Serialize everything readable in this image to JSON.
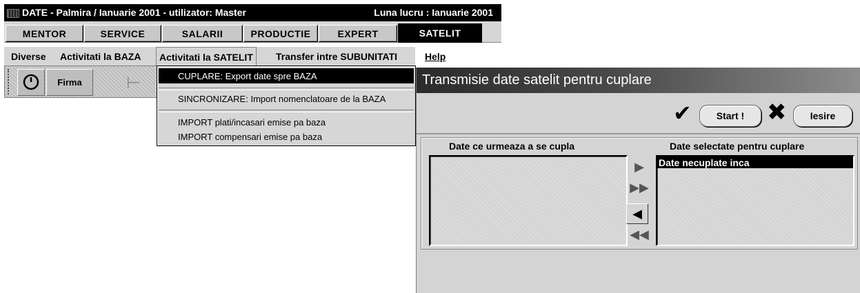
{
  "window": {
    "title": "DATE - Palmira / Ianuarie 2001 - utilizator: Master",
    "working_month": "Luna lucru : Ianuarie 2001"
  },
  "modules": [
    {
      "label": "MENTOR",
      "active": false
    },
    {
      "label": "SERVICE",
      "active": false
    },
    {
      "label": "SALARII",
      "active": false
    },
    {
      "label": "PRODUCTIE",
      "active": false
    },
    {
      "label": "EXPERT",
      "active": false
    },
    {
      "label": "SATELIT",
      "active": true
    }
  ],
  "menu": {
    "items": [
      "Diverse",
      "Activitati la BAZA",
      "Activitati la SATELIT",
      "Transfer intre SUBUNITATI",
      "Help"
    ],
    "open_item": "Activitati la SATELIT"
  },
  "toolbar": {
    "firma_label": "Firma",
    "icons": [
      "clock-icon",
      "sigma-icon"
    ]
  },
  "dropdown": {
    "items": [
      "CUPLARE: Export date spre BAZA",
      "SINCRONIZARE: Import nomenclatoare de la BAZA",
      "IMPORT plati/incasari emise pa baza",
      "IMPORT compensari emise pa baza"
    ],
    "selected_index": 0
  },
  "dialog": {
    "title": "Transmisie date satelit pentru cuplare",
    "start_label": "Start !",
    "exit_label": "Iesire",
    "left_list_label": "Date ce urmeaza a se cupla",
    "right_list_label": "Date selectate pentru cuplare",
    "left_items": [],
    "right_items": [
      "Date necuplate inca"
    ],
    "arrows": [
      "move-right",
      "move-all-right",
      "move-left",
      "move-all-left"
    ]
  },
  "colors": {
    "title_bar": "#000000",
    "menu_bg": "#d6d6d6",
    "dialog_title_start": "#2b2b2b",
    "dialog_title_end": "#8d8d8d",
    "selection": "#000000"
  }
}
